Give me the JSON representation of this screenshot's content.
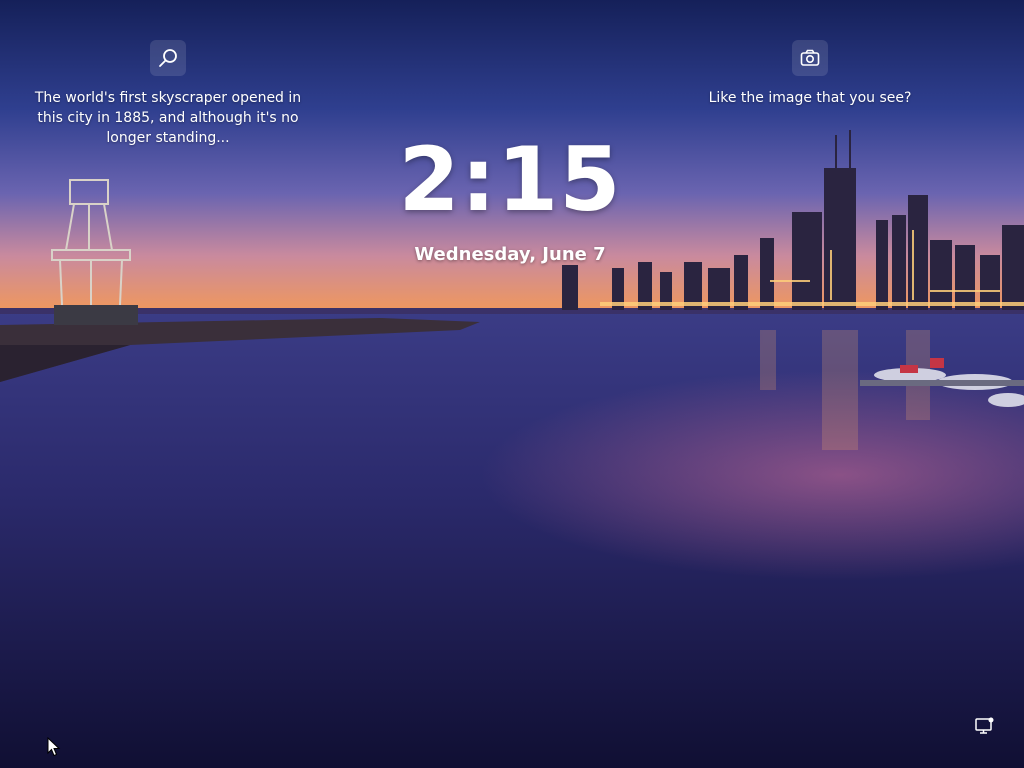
{
  "lock_screen": {
    "time": "2:15",
    "date": "Wednesday, June 7"
  },
  "spotlight": {
    "fact": {
      "icon": "search-icon",
      "text": "The world's first skyscraper opened in this city in 1885, and although it's no longer standing..."
    },
    "feedback": {
      "icon": "camera-icon",
      "text": "Like the image that you see?"
    }
  },
  "status_icons": {
    "network": "network-icon",
    "cursor": "mouse-cursor"
  },
  "colors": {
    "sky_top": "#1b2a6b",
    "sky_mid": "#5a5ba8",
    "horizon": "#e98a5a",
    "water": "#2a2a6e",
    "text": "#ffffff"
  }
}
